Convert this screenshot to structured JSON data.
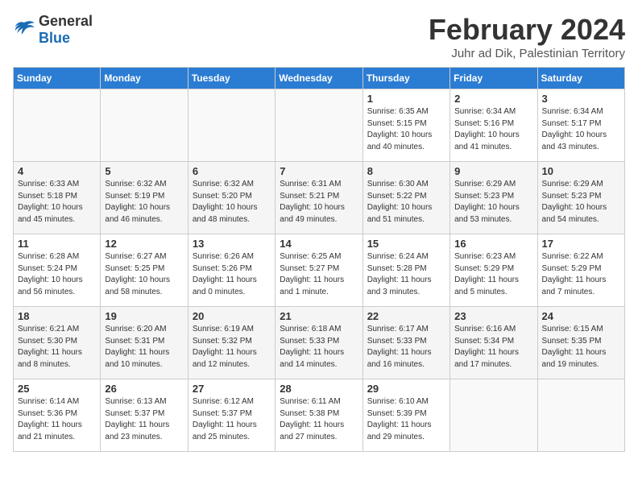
{
  "header": {
    "logo_general": "General",
    "logo_blue": "Blue",
    "month_title": "February 2024",
    "location": "Juhr ad Dik, Palestinian Territory"
  },
  "days_of_week": [
    "Sunday",
    "Monday",
    "Tuesday",
    "Wednesday",
    "Thursday",
    "Friday",
    "Saturday"
  ],
  "weeks": [
    [
      {
        "day": "",
        "info": ""
      },
      {
        "day": "",
        "info": ""
      },
      {
        "day": "",
        "info": ""
      },
      {
        "day": "",
        "info": ""
      },
      {
        "day": "1",
        "info": "Sunrise: 6:35 AM\nSunset: 5:15 PM\nDaylight: 10 hours\nand 40 minutes."
      },
      {
        "day": "2",
        "info": "Sunrise: 6:34 AM\nSunset: 5:16 PM\nDaylight: 10 hours\nand 41 minutes."
      },
      {
        "day": "3",
        "info": "Sunrise: 6:34 AM\nSunset: 5:17 PM\nDaylight: 10 hours\nand 43 minutes."
      }
    ],
    [
      {
        "day": "4",
        "info": "Sunrise: 6:33 AM\nSunset: 5:18 PM\nDaylight: 10 hours\nand 45 minutes."
      },
      {
        "day": "5",
        "info": "Sunrise: 6:32 AM\nSunset: 5:19 PM\nDaylight: 10 hours\nand 46 minutes."
      },
      {
        "day": "6",
        "info": "Sunrise: 6:32 AM\nSunset: 5:20 PM\nDaylight: 10 hours\nand 48 minutes."
      },
      {
        "day": "7",
        "info": "Sunrise: 6:31 AM\nSunset: 5:21 PM\nDaylight: 10 hours\nand 49 minutes."
      },
      {
        "day": "8",
        "info": "Sunrise: 6:30 AM\nSunset: 5:22 PM\nDaylight: 10 hours\nand 51 minutes."
      },
      {
        "day": "9",
        "info": "Sunrise: 6:29 AM\nSunset: 5:23 PM\nDaylight: 10 hours\nand 53 minutes."
      },
      {
        "day": "10",
        "info": "Sunrise: 6:29 AM\nSunset: 5:23 PM\nDaylight: 10 hours\nand 54 minutes."
      }
    ],
    [
      {
        "day": "11",
        "info": "Sunrise: 6:28 AM\nSunset: 5:24 PM\nDaylight: 10 hours\nand 56 minutes."
      },
      {
        "day": "12",
        "info": "Sunrise: 6:27 AM\nSunset: 5:25 PM\nDaylight: 10 hours\nand 58 minutes."
      },
      {
        "day": "13",
        "info": "Sunrise: 6:26 AM\nSunset: 5:26 PM\nDaylight: 11 hours\nand 0 minutes."
      },
      {
        "day": "14",
        "info": "Sunrise: 6:25 AM\nSunset: 5:27 PM\nDaylight: 11 hours\nand 1 minute."
      },
      {
        "day": "15",
        "info": "Sunrise: 6:24 AM\nSunset: 5:28 PM\nDaylight: 11 hours\nand 3 minutes."
      },
      {
        "day": "16",
        "info": "Sunrise: 6:23 AM\nSunset: 5:29 PM\nDaylight: 11 hours\nand 5 minutes."
      },
      {
        "day": "17",
        "info": "Sunrise: 6:22 AM\nSunset: 5:29 PM\nDaylight: 11 hours\nand 7 minutes."
      }
    ],
    [
      {
        "day": "18",
        "info": "Sunrise: 6:21 AM\nSunset: 5:30 PM\nDaylight: 11 hours\nand 8 minutes."
      },
      {
        "day": "19",
        "info": "Sunrise: 6:20 AM\nSunset: 5:31 PM\nDaylight: 11 hours\nand 10 minutes."
      },
      {
        "day": "20",
        "info": "Sunrise: 6:19 AM\nSunset: 5:32 PM\nDaylight: 11 hours\nand 12 minutes."
      },
      {
        "day": "21",
        "info": "Sunrise: 6:18 AM\nSunset: 5:33 PM\nDaylight: 11 hours\nand 14 minutes."
      },
      {
        "day": "22",
        "info": "Sunrise: 6:17 AM\nSunset: 5:33 PM\nDaylight: 11 hours\nand 16 minutes."
      },
      {
        "day": "23",
        "info": "Sunrise: 6:16 AM\nSunset: 5:34 PM\nDaylight: 11 hours\nand 17 minutes."
      },
      {
        "day": "24",
        "info": "Sunrise: 6:15 AM\nSunset: 5:35 PM\nDaylight: 11 hours\nand 19 minutes."
      }
    ],
    [
      {
        "day": "25",
        "info": "Sunrise: 6:14 AM\nSunset: 5:36 PM\nDaylight: 11 hours\nand 21 minutes."
      },
      {
        "day": "26",
        "info": "Sunrise: 6:13 AM\nSunset: 5:37 PM\nDaylight: 11 hours\nand 23 minutes."
      },
      {
        "day": "27",
        "info": "Sunrise: 6:12 AM\nSunset: 5:37 PM\nDaylight: 11 hours\nand 25 minutes."
      },
      {
        "day": "28",
        "info": "Sunrise: 6:11 AM\nSunset: 5:38 PM\nDaylight: 11 hours\nand 27 minutes."
      },
      {
        "day": "29",
        "info": "Sunrise: 6:10 AM\nSunset: 5:39 PM\nDaylight: 11 hours\nand 29 minutes."
      },
      {
        "day": "",
        "info": ""
      },
      {
        "day": "",
        "info": ""
      }
    ]
  ]
}
